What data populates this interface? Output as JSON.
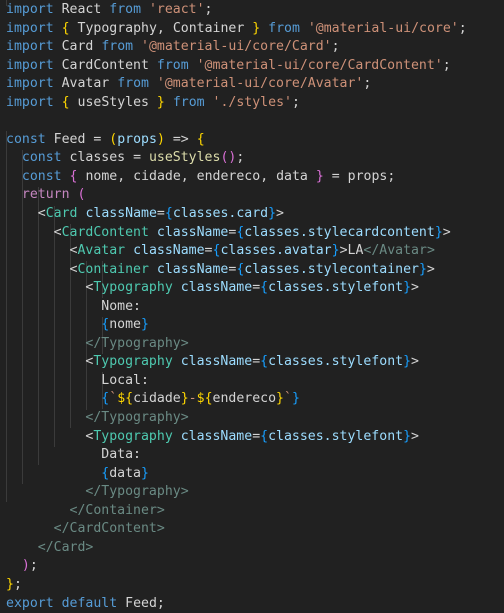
{
  "editor": {
    "language": "javascript-react",
    "theme": "dark-plus",
    "background_color": "#212121",
    "default_text_color": "#d4d4d4",
    "font_size_px": 13.2,
    "line_height_px": 18.55,
    "total_lines": 29,
    "colors": {
      "keyword": "#569cd6",
      "control_keyword": "#c586c0",
      "string": "#ce9178",
      "jsx_tag": "#4ec9b0",
      "jsx_closing_tag": "#6a8a84",
      "attribute": "#9cdcfe",
      "function": "#dcdcaa",
      "identifier": "#d4d4d4",
      "bracket_level_1": "#ffd700",
      "bracket_level_2": "#da70d6",
      "bracket_level_3": "#179fff",
      "indent_guide": "#3b3b3b"
    }
  },
  "code": {
    "lines": [
      "import React from 'react';",
      "import { Typography, Container } from '@material-ui/core';",
      "import Card from '@material-ui/core/Card';",
      "import CardContent from '@material-ui/core/CardContent';",
      "import Avatar from '@material-ui/core/Avatar';",
      "import { useStyles } from './styles';",
      "",
      "const Feed = (props) => {",
      "  const classes = useStyles();",
      "  const { nome, cidade, endereco, data } = props;",
      "  return (",
      "    <Card className={classes.card}>",
      "      <CardContent className={classes.stylecardcontent}>",
      "        <Avatar className={classes.avatar}>LA</Avatar>",
      "        <Container className={classes.stylecontainer}>",
      "          <Typography className={classes.stylefont}>",
      "            Nome:",
      "            {nome}",
      "          </Typography>",
      "          <Typography className={classes.stylefont}>",
      "            Local:",
      "            {`${cidade}-${endereco}`}",
      "          </Typography>",
      "          <Typography className={classes.stylefont}>",
      "            Data:",
      "            {data}",
      "          </Typography>",
      "        </Container>",
      "      </CardContent>",
      "    </Card>",
      "  );",
      "};",
      "export default Feed;"
    ],
    "imports": [
      {
        "default_import": "React",
        "source": "react"
      },
      {
        "named_imports": "Typography, Container",
        "source": "@material-ui/core"
      },
      {
        "default_import": "Card",
        "source": "@material-ui/core/Card"
      },
      {
        "default_import": "CardContent",
        "source": "@material-ui/core/CardContent"
      },
      {
        "default_import": "Avatar",
        "source": "@material-ui/core/Avatar"
      },
      {
        "named_imports": "useStyles",
        "source": "./styles"
      }
    ],
    "component_name": "Feed",
    "destructured_props": "nome, cidade, endereco, data",
    "avatar_initials": "LA",
    "labels": [
      "Nome:",
      "Local:",
      "Data:"
    ],
    "style_classes": [
      "card",
      "stylecardcontent",
      "avatar",
      "stylecontainer",
      "stylefont"
    ],
    "export_statement": "export default Feed;"
  },
  "tokens": {
    "kw_import": "import",
    "kw_from": "from",
    "kw_const": "const",
    "kw_return": "return",
    "kw_export": "export",
    "kw_default": "default",
    "id_react": "React",
    "id_typography": "Typography",
    "id_container": "Container",
    "id_card": "Card",
    "id_cardcontent": "CardContent",
    "id_avatar": "Avatar",
    "id_usestyles": "useStyles",
    "id_feed": "Feed",
    "id_classes": "classes",
    "id_props": "props",
    "id_nome": "nome",
    "id_cidade": "cidade",
    "id_endereco": "endereco",
    "id_data": "data",
    "attr_classname": "className",
    "str_react": "'react'",
    "str_core": "'@material-ui/core'",
    "str_core_card": "'@material-ui/core/Card'",
    "str_core_cardcontent": "'@material-ui/core/CardContent'",
    "str_core_avatar": "'@material-ui/core/Avatar'",
    "str_styles": "'./styles'",
    "text_nome": "Nome:",
    "text_local": "Local:",
    "text_data": "Data:",
    "text_la": "LA",
    "prop_card": ".card",
    "prop_stylecardcontent": ".stylecardcontent",
    "prop_avatar": ".avatar",
    "prop_stylecontainer": ".stylecontainer",
    "prop_stylefont": ".stylefont"
  }
}
